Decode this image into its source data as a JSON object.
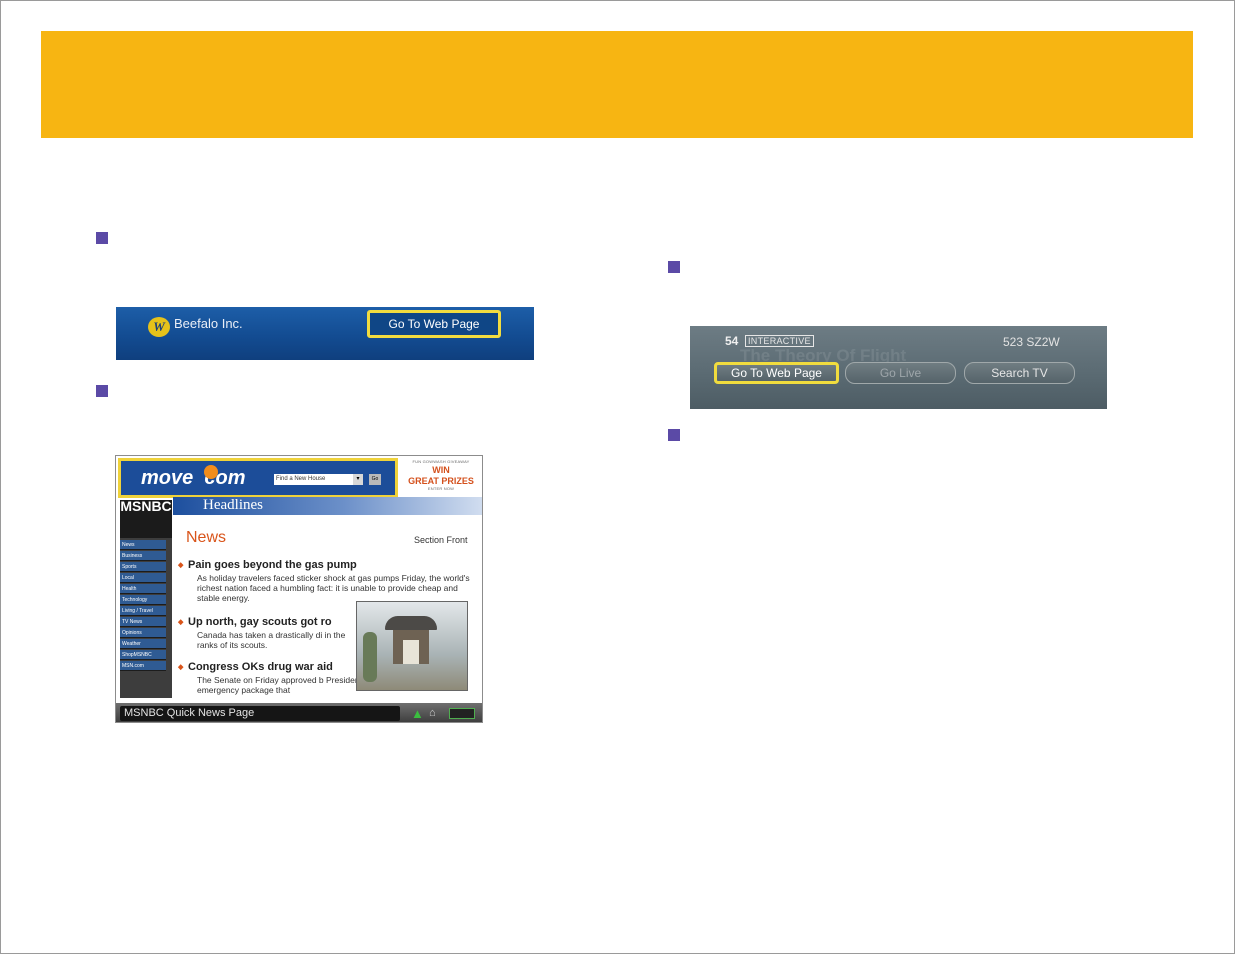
{
  "beefalo_bar": {
    "logo_letter": "W",
    "company_name": "Beefalo Inc.",
    "go_button": "Go To Web Page"
  },
  "msnbc_page": {
    "ad": {
      "brand": "move",
      "brand_suffix": "com",
      "search_placeholder": "Find a New House",
      "dropdown_arrow": "▾",
      "go_label": "Go",
      "promo_line": "FUN GOWWASH GIVEAWAY",
      "prize_line1": "WIN",
      "prize_line2": "GREAT PRIZES",
      "promo_footer": "ENTER NOW"
    },
    "logo": "MSNBC",
    "headlines_label": "Headlines",
    "nav_items": [
      "News",
      "Business",
      "Sports",
      "Local",
      "Health",
      "Technology",
      "Living / Travel",
      "TV News",
      "Opinions",
      "Weather",
      "ShopMSNBC",
      "MSN.com"
    ],
    "section_title": "News",
    "section_front": "Section Front",
    "stories": [
      {
        "headline": "Pain goes beyond the gas pump",
        "body": "As holiday travelers faced sticker shock at gas pumps Friday, the world's richest nation faced a humbling fact: it is unable to provide cheap and stable energy."
      },
      {
        "headline": "Up north, gay scouts got ro",
        "body": "Canada has taken a drastically di in the ranks of its scouts."
      },
      {
        "headline": "Congress OKs drug war aid",
        "body": "The Senate on Friday approved b President Clinton an $11.2 billion emergency package that"
      }
    ],
    "ticker_label": "MSNBC Quick News Page",
    "ticker_up_icon": "▲",
    "ticker_home_icon": "⌂"
  },
  "tv_bar": {
    "channel": "54",
    "badge": "INTERACTIVE",
    "ghost_title": "The Theory Of Flight",
    "time": "523 SZ2W",
    "buttons": [
      "Go To Web Page",
      "Go Live",
      "Search TV"
    ],
    "selected_button": "Go To Web Page"
  }
}
